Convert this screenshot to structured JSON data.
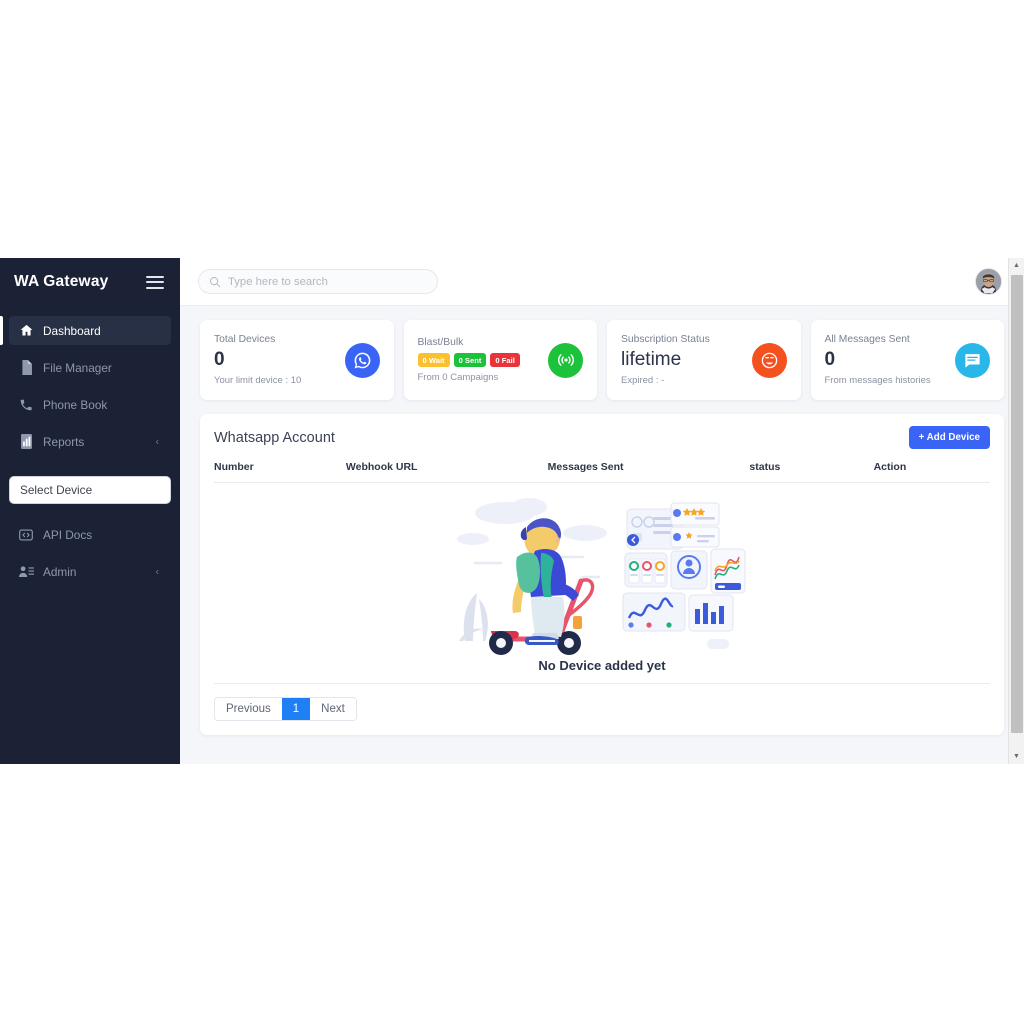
{
  "sidebar": {
    "brand": "WA Gateway",
    "burger_icon": "hamburger-menu-icon",
    "items": [
      {
        "label": "Dashboard",
        "icon": "home-icon",
        "active": true,
        "caret": ""
      },
      {
        "label": "File Manager",
        "icon": "file-icon",
        "active": false,
        "caret": ""
      },
      {
        "label": "Phone Book",
        "icon": "phone-icon",
        "active": false,
        "caret": ""
      },
      {
        "label": "Reports",
        "icon": "bar-chart-icon",
        "active": false,
        "caret": "‹"
      }
    ],
    "device_select": {
      "label": "Select Device"
    },
    "items_bottom": [
      {
        "label": "API Docs",
        "icon": "code-icon",
        "caret": ""
      },
      {
        "label": "Admin",
        "icon": "users-icon",
        "caret": "‹"
      }
    ]
  },
  "topbar": {
    "search": {
      "placeholder": "Type here to search",
      "value": "",
      "icon": "search-icon"
    },
    "avatar_name": "user-avatar"
  },
  "cards": [
    {
      "title": "Total Devices",
      "value": "0",
      "sub": "Your limit device : 10",
      "icon": "whatsapp-icon",
      "color": "#3a64f5"
    },
    {
      "title": "Blast/Bulk",
      "value": "",
      "sub": "From 0 Campaigns",
      "icon": "broadcast-icon",
      "color": "#1bc23a",
      "badges": [
        {
          "label": "0 Wait",
          "color": "#fbc02d"
        },
        {
          "label": "0 Sent",
          "color": "#1bc23a"
        },
        {
          "label": "0 Fail",
          "color": "#e8333b"
        }
      ]
    },
    {
      "title": "Subscription Status",
      "value": "lifetime",
      "sub": "Expired : -",
      "icon": "smiley-icon",
      "color": "#f4511e"
    },
    {
      "title": "All Messages Sent",
      "value": "0",
      "sub": "From messages histories",
      "icon": "chat-icon",
      "color": "#29b6e8"
    }
  ],
  "panel": {
    "title": "Whatsapp Account",
    "add_button": "+  Add Device",
    "columns": [
      "Number",
      "Webhook URL",
      "Messages Sent",
      "status",
      "Action"
    ],
    "rows": [],
    "empty_text": "No Device added yet",
    "empty_illustration": "scooter-rider-dashboard-illustration",
    "pagination": {
      "previous": "Previous",
      "pages": [
        "1"
      ],
      "current": "1",
      "next": "Next"
    }
  },
  "scrollbar": {
    "up_icon": "▲",
    "down_icon": "▼"
  }
}
